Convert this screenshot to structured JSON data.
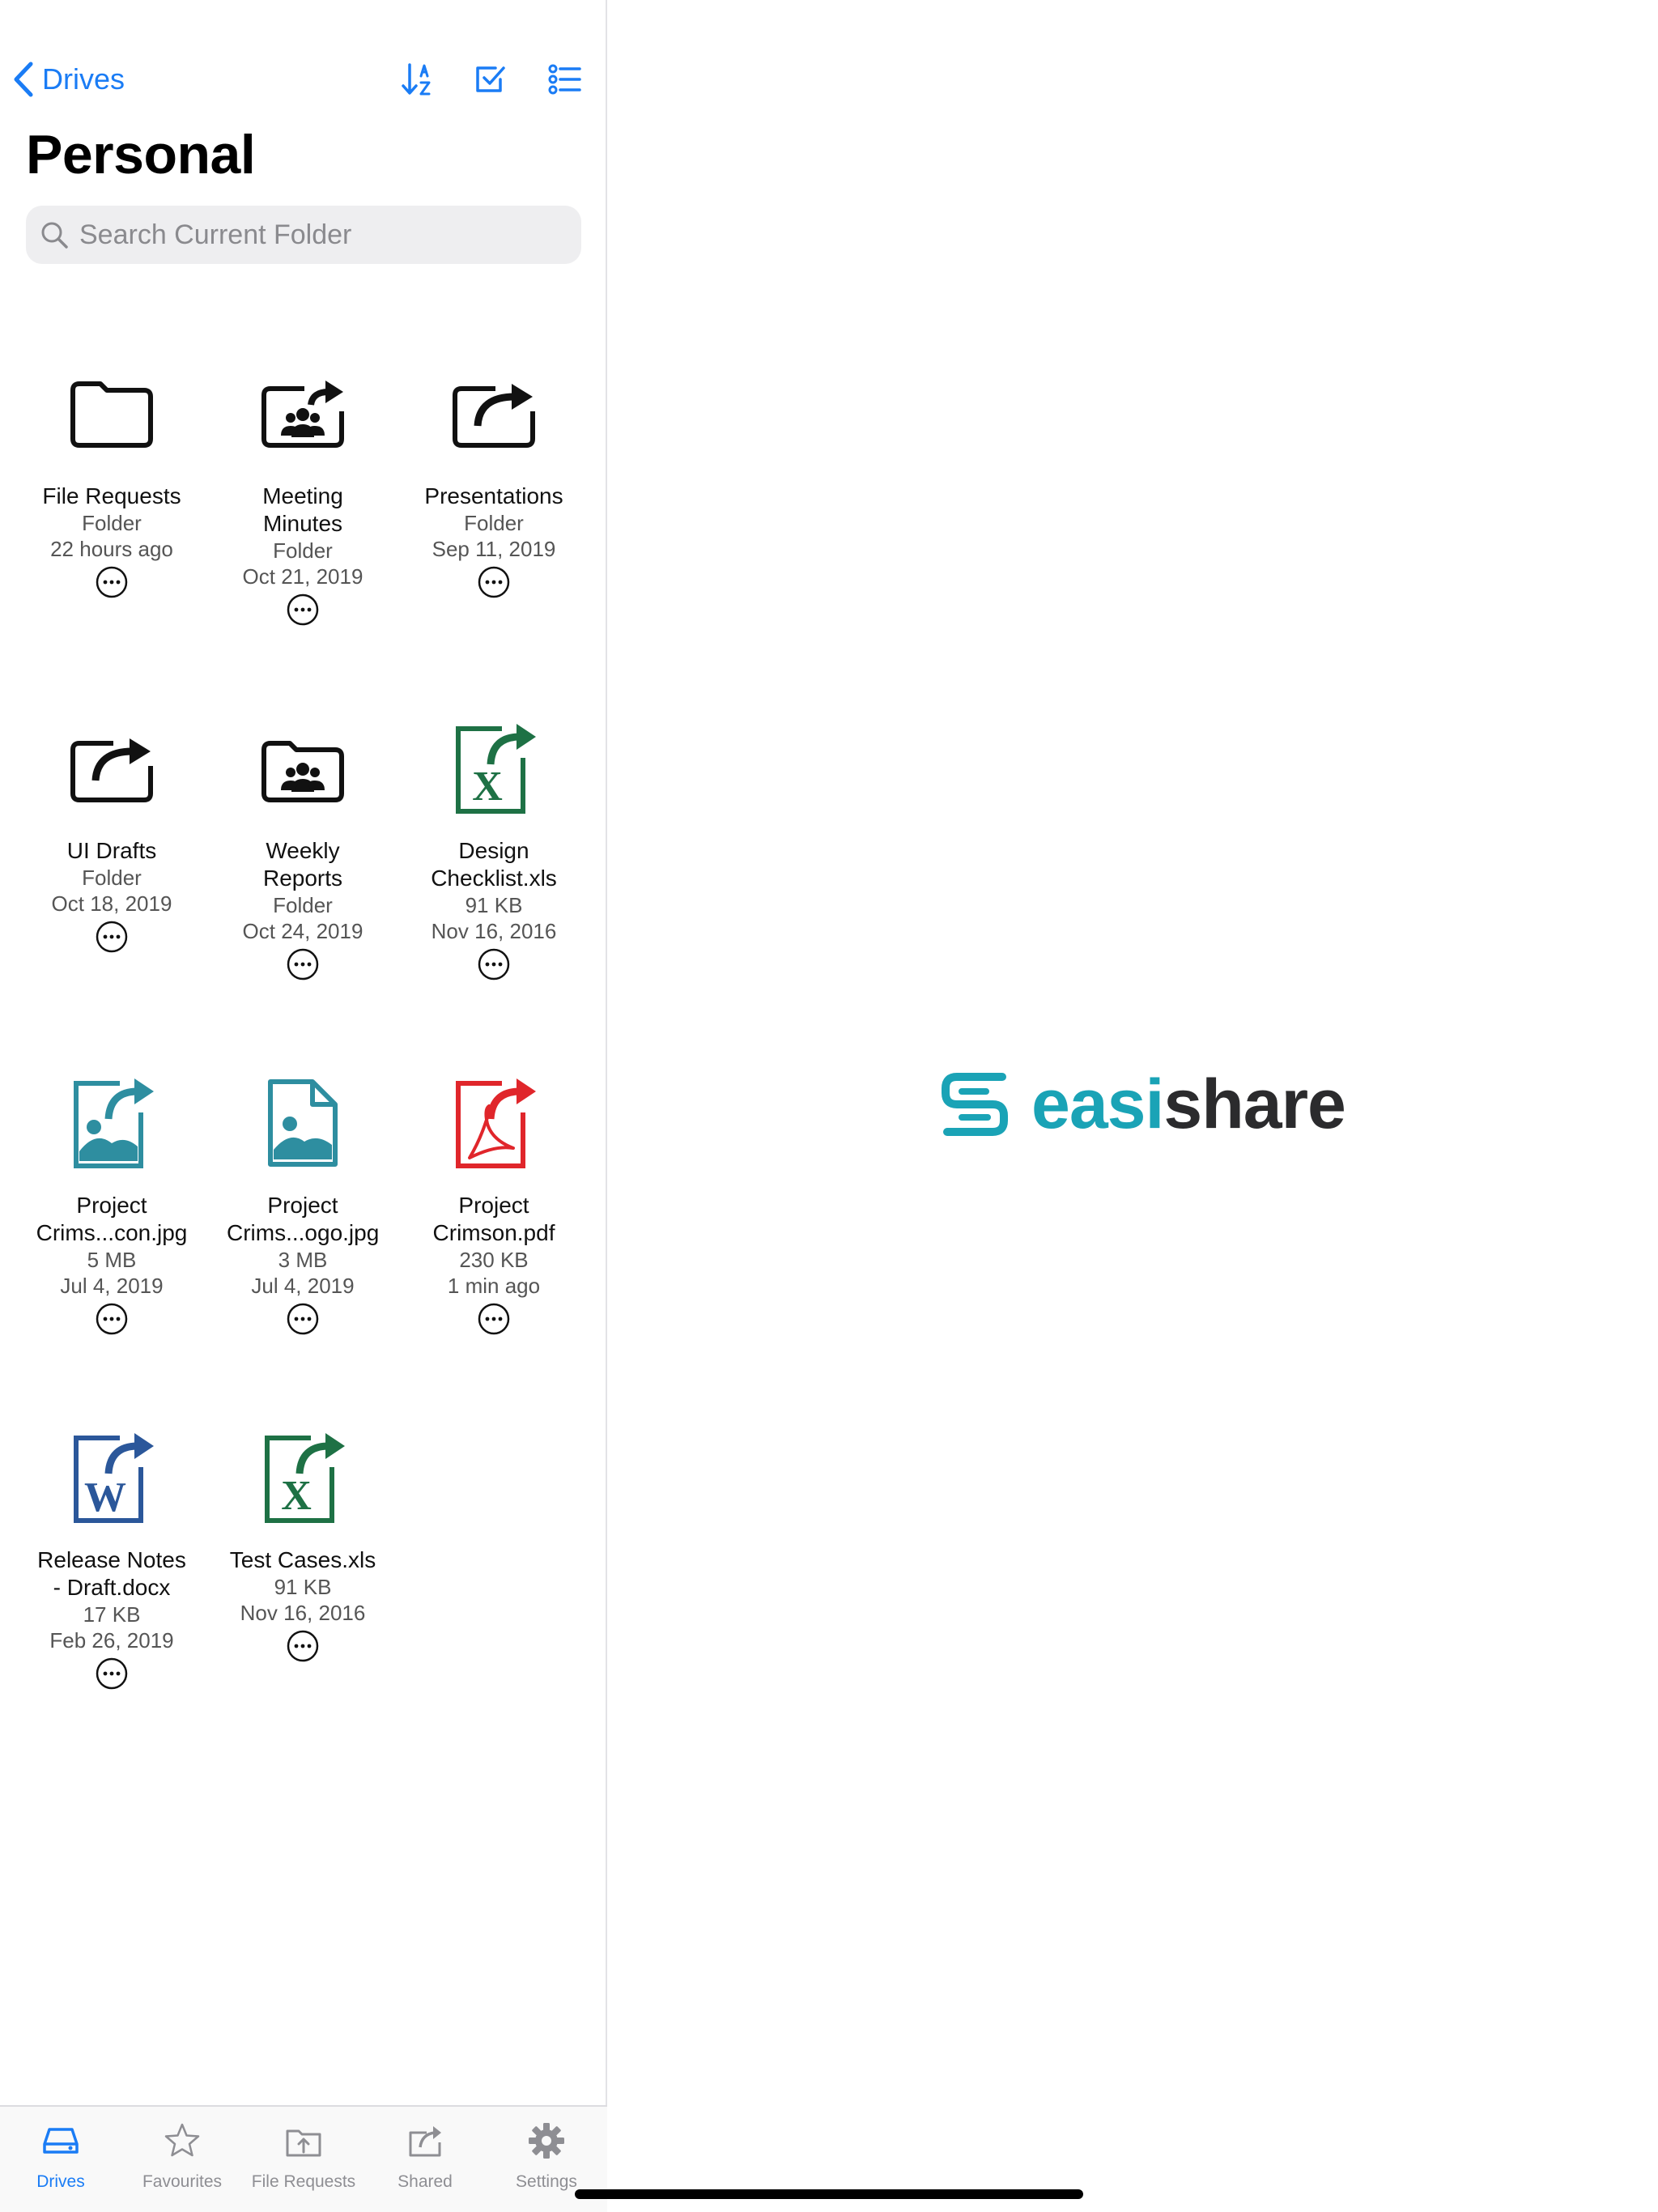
{
  "nav": {
    "back_label": "Drives",
    "title": "Personal"
  },
  "search": {
    "placeholder": "Search Current Folder"
  },
  "items": [
    {
      "name": "File Requests",
      "type": "Folder",
      "date": "22 hours ago",
      "icon": "folder-icon"
    },
    {
      "name": "Meeting Minutes",
      "type": "Folder",
      "date": "Oct 21, 2019",
      "icon": "shared-team-folder-icon"
    },
    {
      "name": "Presentations",
      "type": "Folder",
      "date": "Sep 11, 2019",
      "icon": "shared-folder-icon"
    },
    {
      "name": "UI Drafts",
      "type": "Folder",
      "date": "Oct 18, 2019",
      "icon": "shared-folder-icon"
    },
    {
      "name": "Weekly Reports",
      "type": "Folder",
      "date": "Oct 24, 2019",
      "icon": "team-folder-icon"
    },
    {
      "name": "Design Checklist.xls",
      "type": "91 KB",
      "date": "Nov 16, 2016",
      "icon": "excel-shared-icon"
    },
    {
      "name": "Project Crims...con.jpg",
      "type": "5 MB",
      "date": "Jul 4, 2019",
      "icon": "image-shared-icon"
    },
    {
      "name": "Project Crims...ogo.jpg",
      "type": "3 MB",
      "date": "Jul 4, 2019",
      "icon": "image-icon"
    },
    {
      "name": "Project Crimson.pdf",
      "type": "230 KB",
      "date": "1 min ago",
      "icon": "pdf-shared-icon"
    },
    {
      "name": "Release Notes - Draft.docx",
      "type": "17 KB",
      "date": "Feb 26, 2019",
      "icon": "word-shared-icon"
    },
    {
      "name": "Test Cases.xls",
      "type": "91 KB",
      "date": "Nov 16, 2016",
      "icon": "excel-shared-icon"
    }
  ],
  "tabs": [
    {
      "label": "Drives",
      "active": true,
      "icon": "drive-icon"
    },
    {
      "label": "Favourites",
      "active": false,
      "icon": "star-icon"
    },
    {
      "label": "File Requests",
      "active": false,
      "icon": "file-request-icon"
    },
    {
      "label": "Shared",
      "active": false,
      "icon": "shared-icon"
    },
    {
      "label": "Settings",
      "active": false,
      "icon": "gear-icon"
    }
  ],
  "logo": {
    "part1": "easi",
    "part2": "share"
  },
  "colors": {
    "accent": "#1a7cf5",
    "excel": "#1e7145",
    "image": "#2e8ea0",
    "pdf": "#e0262b",
    "word": "#2b579a",
    "logo_teal": "#1aa3b6"
  }
}
